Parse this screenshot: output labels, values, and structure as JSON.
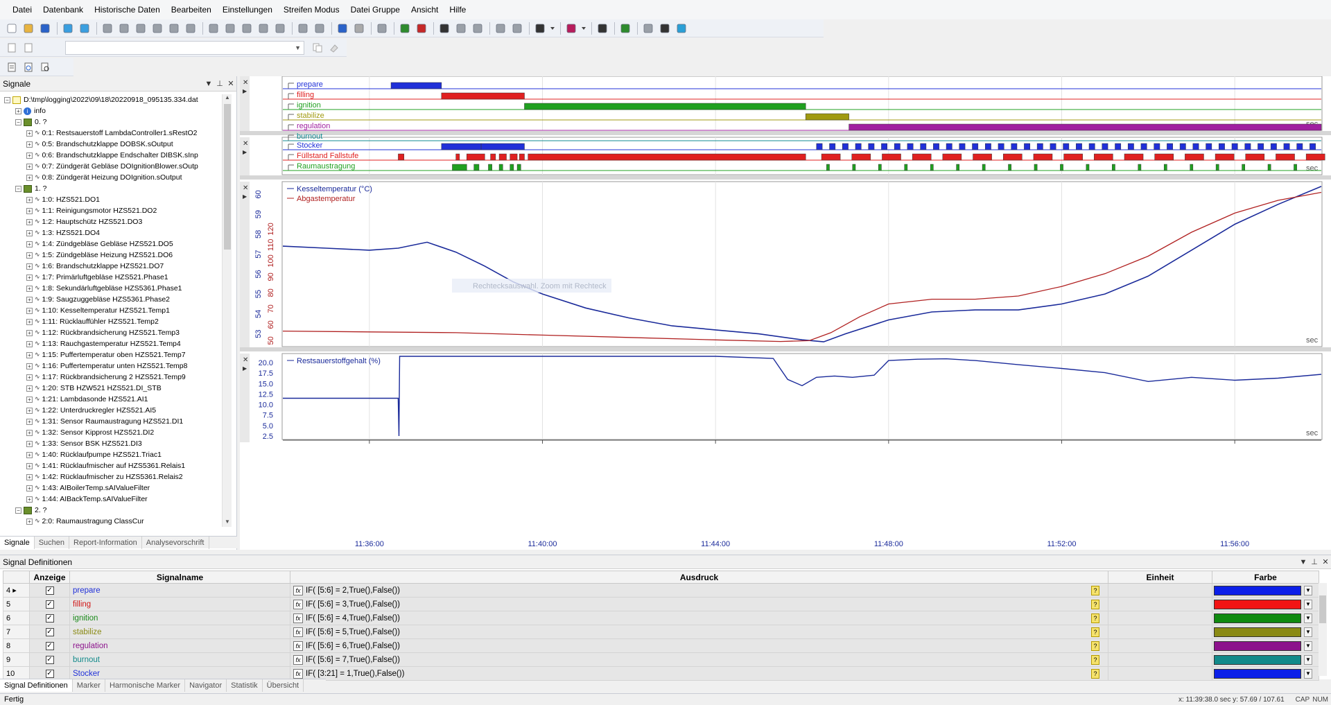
{
  "menu": [
    "Datei",
    "Datenbank",
    "Historische Daten",
    "Bearbeiten",
    "Einstellungen",
    "Streifen Modus",
    "Datei Gruppe",
    "Ansicht",
    "Hilfe"
  ],
  "signals_panel": {
    "title": "Signale",
    "tree": [
      {
        "level": 0,
        "type": "file",
        "label": "D:\\tmp\\logging\\2022\\09\\18\\20220918_095135.334.dat"
      },
      {
        "level": 1,
        "type": "info",
        "label": "info"
      },
      {
        "level": 1,
        "type": "group",
        "label": "0. ?"
      },
      {
        "level": 2,
        "type": "sig",
        "label": "0:1: Restsauerstoff LambdaController1.sRestO2"
      },
      {
        "level": 2,
        "type": "sig",
        "label": "0:5: Brandschutzklappe DOBSK.sOutput"
      },
      {
        "level": 2,
        "type": "sig",
        "label": "0:6: Brandschutzklappe Endschalter DIBSK.sInp"
      },
      {
        "level": 2,
        "type": "sig",
        "label": "0:7: Zündgerät Gebläse DOIgnitionBlower.sOutp"
      },
      {
        "level": 2,
        "type": "sig",
        "label": "0:8: Zündgerät Heizung DOIgnition.sOutput"
      },
      {
        "level": 1,
        "type": "group",
        "label": "1. ?"
      },
      {
        "level": 2,
        "type": "sig",
        "label": "1:0: HZS521.DO1"
      },
      {
        "level": 2,
        "type": "sig",
        "label": "1:1: Reinigungsmotor HZS521.DO2"
      },
      {
        "level": 2,
        "type": "sig",
        "label": "1:2: Hauptschütz HZS521.DO3"
      },
      {
        "level": 2,
        "type": "sig",
        "label": "1:3: HZS521.DO4"
      },
      {
        "level": 2,
        "type": "sig",
        "label": "1:4: Zündgebläse Gebläse HZS521.DO5"
      },
      {
        "level": 2,
        "type": "sig",
        "label": "1:5: Zündgebläse Heizung HZS521.DO6"
      },
      {
        "level": 2,
        "type": "sig",
        "label": "1:6: Brandschutzklappe HZS521.DO7"
      },
      {
        "level": 2,
        "type": "sig",
        "label": "1:7: Primärluftgebläse HZS521.Phase1"
      },
      {
        "level": 2,
        "type": "sig",
        "label": "1:8: Sekundärluftgebläse HZS5361.Phase1"
      },
      {
        "level": 2,
        "type": "sig",
        "label": "1:9: Saugzuggebläse HZS5361.Phase2"
      },
      {
        "level": 2,
        "type": "sig",
        "label": "1:10: Kesseltemperatur HZS521.Temp1"
      },
      {
        "level": 2,
        "type": "sig",
        "label": "1:11: Rücklauffühler HZS521.Temp2"
      },
      {
        "level": 2,
        "type": "sig",
        "label": "1:12: Rückbrandsicherung HZS521.Temp3"
      },
      {
        "level": 2,
        "type": "sig",
        "label": "1:13: Rauchgastemperatur HZS521.Temp4"
      },
      {
        "level": 2,
        "type": "sig",
        "label": "1:15: Puffertemperatur oben HZS521.Temp7"
      },
      {
        "level": 2,
        "type": "sig",
        "label": "1:16: Puffertemperatur unten HZS521.Temp8"
      },
      {
        "level": 2,
        "type": "sig",
        "label": "1:17: Rückbrandsicherung 2 HZS521.Temp9"
      },
      {
        "level": 2,
        "type": "sig",
        "label": "1:20: STB HZW521 HZS521.DI_STB"
      },
      {
        "level": 2,
        "type": "sig",
        "label": "1:21: Lambdasonde HZS521.AI1"
      },
      {
        "level": 2,
        "type": "sig",
        "label": "1:22: Unterdruckregler HZS521.AI5"
      },
      {
        "level": 2,
        "type": "sig",
        "label": "1:31: Sensor Raumaustragung HZS521.DI1"
      },
      {
        "level": 2,
        "type": "sig",
        "label": "1:32: Sensor Kipprost HZS521.DI2"
      },
      {
        "level": 2,
        "type": "sig",
        "label": "1:33: Sensor BSK HZS521.DI3"
      },
      {
        "level": 2,
        "type": "sig",
        "label": "1:40: Rücklaufpumpe HZS521.Triac1"
      },
      {
        "level": 2,
        "type": "sig",
        "label": "1:41: Rücklaufmischer auf HZS5361.Relais1"
      },
      {
        "level": 2,
        "type": "sig",
        "label": "1:42: Rücklaufmischer zu HZS5361.Relais2"
      },
      {
        "level": 2,
        "type": "sig",
        "label": "1:43: AIBoilerTemp.sAIValueFilter"
      },
      {
        "level": 2,
        "type": "sig",
        "label": "1:44: AIBackTemp.sAIValueFilter"
      },
      {
        "level": 1,
        "type": "group",
        "label": "2. ?"
      },
      {
        "level": 2,
        "type": "sig",
        "label": "2:0: Raumaustragung ClassCur"
      }
    ],
    "tabs": [
      "Signale",
      "Suchen",
      "Report-Information",
      "Analysevorschrift"
    ]
  },
  "chart_data": [
    {
      "type": "state",
      "title": "",
      "labels": [
        "prepare",
        "filling",
        "ignition",
        "stabilize",
        "regulation",
        "burnout"
      ],
      "colors": [
        "#2030d8",
        "#e02020",
        "#20a020",
        "#a09a10",
        "#a020a0",
        "#108890"
      ],
      "segments": [
        {
          "series": "prepare",
          "start": "11:36:30",
          "end": "11:37:40"
        },
        {
          "series": "filling",
          "start": "11:37:40",
          "end": "11:39:35"
        },
        {
          "series": "ignition",
          "start": "11:39:35",
          "end": "11:46:05"
        },
        {
          "series": "stabilize",
          "start": "11:46:05",
          "end": "11:47:05"
        },
        {
          "series": "regulation",
          "start": "11:47:05",
          "end": "11:58:00"
        }
      ],
      "unit": "sec"
    },
    {
      "type": "digital",
      "labels": [
        "Stocker",
        "Füllstand Fallstufe",
        "Raumaustragung"
      ],
      "colors": [
        "#2030d8",
        "#e02020",
        "#20a020"
      ],
      "pulses": {
        "Stocker": [
          [
            "11:37:40",
            "11:38:35"
          ],
          [
            "11:38:35",
            "11:39:35"
          ]
        ],
        "Füllstand Fallstufe": [
          [
            "11:36:40",
            "11:36:48"
          ],
          [
            "11:38:00",
            "11:38:05"
          ],
          [
            "11:38:15",
            "11:38:40"
          ],
          [
            "11:38:48",
            "11:38:55"
          ],
          [
            "11:39:00",
            "11:39:10"
          ],
          [
            "11:39:15",
            "11:39:25"
          ],
          [
            "11:39:28",
            "11:39:35"
          ],
          [
            "11:39:40",
            "11:46:05"
          ]
        ],
        "Raumaustragung": [
          [
            "11:37:55",
            "11:38:15"
          ],
          [
            "11:38:25",
            "11:38:32"
          ],
          [
            "11:38:45",
            "11:38:50"
          ],
          [
            "11:39:00",
            "11:39:05"
          ],
          [
            "11:39:15",
            "11:39:20"
          ],
          [
            "11:39:25",
            "11:39:30"
          ]
        ]
      },
      "unit": "sec"
    },
    {
      "type": "line",
      "series": [
        {
          "name": "Kesseltemperatur (°C)",
          "color": "#1a2a9a",
          "axis": [
            52.5,
            60.5
          ],
          "ticks": [
            53,
            54,
            55,
            56,
            57,
            58,
            59,
            60
          ],
          "x": [
            "11:34:00",
            "11:35:00",
            "11:36:00",
            "11:36:40",
            "11:37:20",
            "11:38:00",
            "11:38:40",
            "11:39:20",
            "11:40:00",
            "11:41:00",
            "11:42:00",
            "11:43:00",
            "11:44:00",
            "11:45:00",
            "11:46:00",
            "11:46:30",
            "11:47:00",
            "11:48:00",
            "11:49:00",
            "11:50:00",
            "11:51:00",
            "11:52:00",
            "11:53:00",
            "11:54:00",
            "11:55:00",
            "11:56:00",
            "11:57:00",
            "11:58:00"
          ],
          "y": [
            57.4,
            57.3,
            57.2,
            57.3,
            57.6,
            57.1,
            56.4,
            55.6,
            55.0,
            54.3,
            53.8,
            53.4,
            53.2,
            53.0,
            52.7,
            52.6,
            53.0,
            53.7,
            54.1,
            54.2,
            54.2,
            54.5,
            55.0,
            55.9,
            57.2,
            58.5,
            59.5,
            60.4
          ]
        },
        {
          "name": "Abgastemperatur",
          "color": "#b02020",
          "axis": [
            48,
            148
          ],
          "ticks": [
            50,
            60,
            70,
            80,
            90,
            100,
            110,
            120
          ],
          "x": [
            "11:34:00",
            "11:36:00",
            "11:38:00",
            "11:40:00",
            "11:42:00",
            "11:44:00",
            "11:45:30",
            "11:46:10",
            "11:46:40",
            "11:47:20",
            "11:48:00",
            "11:49:00",
            "11:50:00",
            "11:51:00",
            "11:52:00",
            "11:53:00",
            "11:54:00",
            "11:55:00",
            "11:56:00",
            "11:57:00",
            "11:58:00"
          ],
          "y": [
            56,
            55.5,
            55,
            53.5,
            52,
            50.5,
            49.5,
            50,
            55,
            65,
            73,
            76,
            76,
            78,
            84,
            92,
            103,
            118,
            130,
            138,
            143
          ]
        }
      ],
      "unit": "sec"
    },
    {
      "type": "line",
      "series": [
        {
          "name": "Restsauerstoffgehalt (%)",
          "color": "#1a2a9a",
          "x": [
            "11:34:00",
            "11:36:40",
            "11:36:41",
            "11:36:42",
            "11:40:00",
            "11:44:00",
            "11:45:20",
            "11:45:40",
            "11:46:00",
            "11:46:20",
            "11:46:45",
            "11:47:10",
            "11:47:40",
            "11:48:00",
            "11:48:40",
            "11:49:20",
            "11:50:00",
            "11:51:00",
            "11:52:00",
            "11:53:00",
            "11:54:00",
            "11:55:00",
            "11:56:00",
            "11:57:00",
            "11:58:00"
          ],
          "y": [
            11.5,
            11.5,
            2.5,
            21.5,
            21.5,
            21.5,
            21.0,
            16.0,
            14.5,
            16.5,
            16.8,
            16.5,
            17.0,
            20.5,
            20.8,
            20.9,
            20.5,
            19.5,
            18.6,
            17.6,
            15.5,
            16.5,
            15.8,
            16.3,
            17.2
          ]
        }
      ],
      "yticks": [
        2.5,
        5.0,
        7.5,
        10.0,
        12.5,
        15.0,
        17.5,
        20.0
      ],
      "ylim": [
        2.0,
        21.5
      ],
      "unit": "sec"
    }
  ],
  "time_axis": {
    "start": "11:34:00",
    "end": "11:58:00",
    "ticks": [
      "11:36:00",
      "11:40:00",
      "11:44:00",
      "11:48:00",
      "11:52:00",
      "11:56:00"
    ]
  },
  "watermark": "Rechtecksauswahl. Zoom mit Rechteck",
  "signal_definitions": {
    "title": "Signal Definitionen",
    "columns": [
      "Anzeige",
      "Signalname",
      "Ausdruck",
      "Einheit",
      "Farbe"
    ],
    "rows": [
      {
        "num": "4",
        "name": "prepare",
        "expr": "IF( [5:6] = 2,True(),False())",
        "color": "#0b1fe8",
        "text_color": "#2030d8"
      },
      {
        "num": "5",
        "name": "filling",
        "expr": "IF( [5:6] = 3,True(),False())",
        "color": "#f21414",
        "text_color": "#d01818"
      },
      {
        "num": "6",
        "name": "ignition",
        "expr": "IF( [5:6] = 4,True(),False())",
        "color": "#0f8a0f",
        "text_color": "#1a8a1a"
      },
      {
        "num": "7",
        "name": "stabilize",
        "expr": "IF( [5:6] = 5,True(),False())",
        "color": "#8a8a14",
        "text_color": "#8a8a14"
      },
      {
        "num": "8",
        "name": "regulation",
        "expr": "IF( [5:6] = 6,True(),False())",
        "color": "#8c128c",
        "text_color": "#8c128c"
      },
      {
        "num": "9",
        "name": "burnout",
        "expr": "IF( [5:6] = 7,True(),False())",
        "color": "#128a8a",
        "text_color": "#128a8a"
      },
      {
        "num": "10",
        "name": "Stocker",
        "expr": "IF( [3:21] = 1,True(),False())",
        "color": "#0b1fe8",
        "text_color": "#2030d8"
      }
    ],
    "tabs": [
      "Signal Definitionen",
      "Marker",
      "Harmonische Marker",
      "Navigator",
      "Statistik",
      "Übersicht"
    ]
  },
  "status": {
    "text": "Fertig",
    "coords": "x: 11:39:38.0 sec   y: 57.69 / 107.61",
    "indicators": [
      "CAP",
      "NUM"
    ]
  }
}
